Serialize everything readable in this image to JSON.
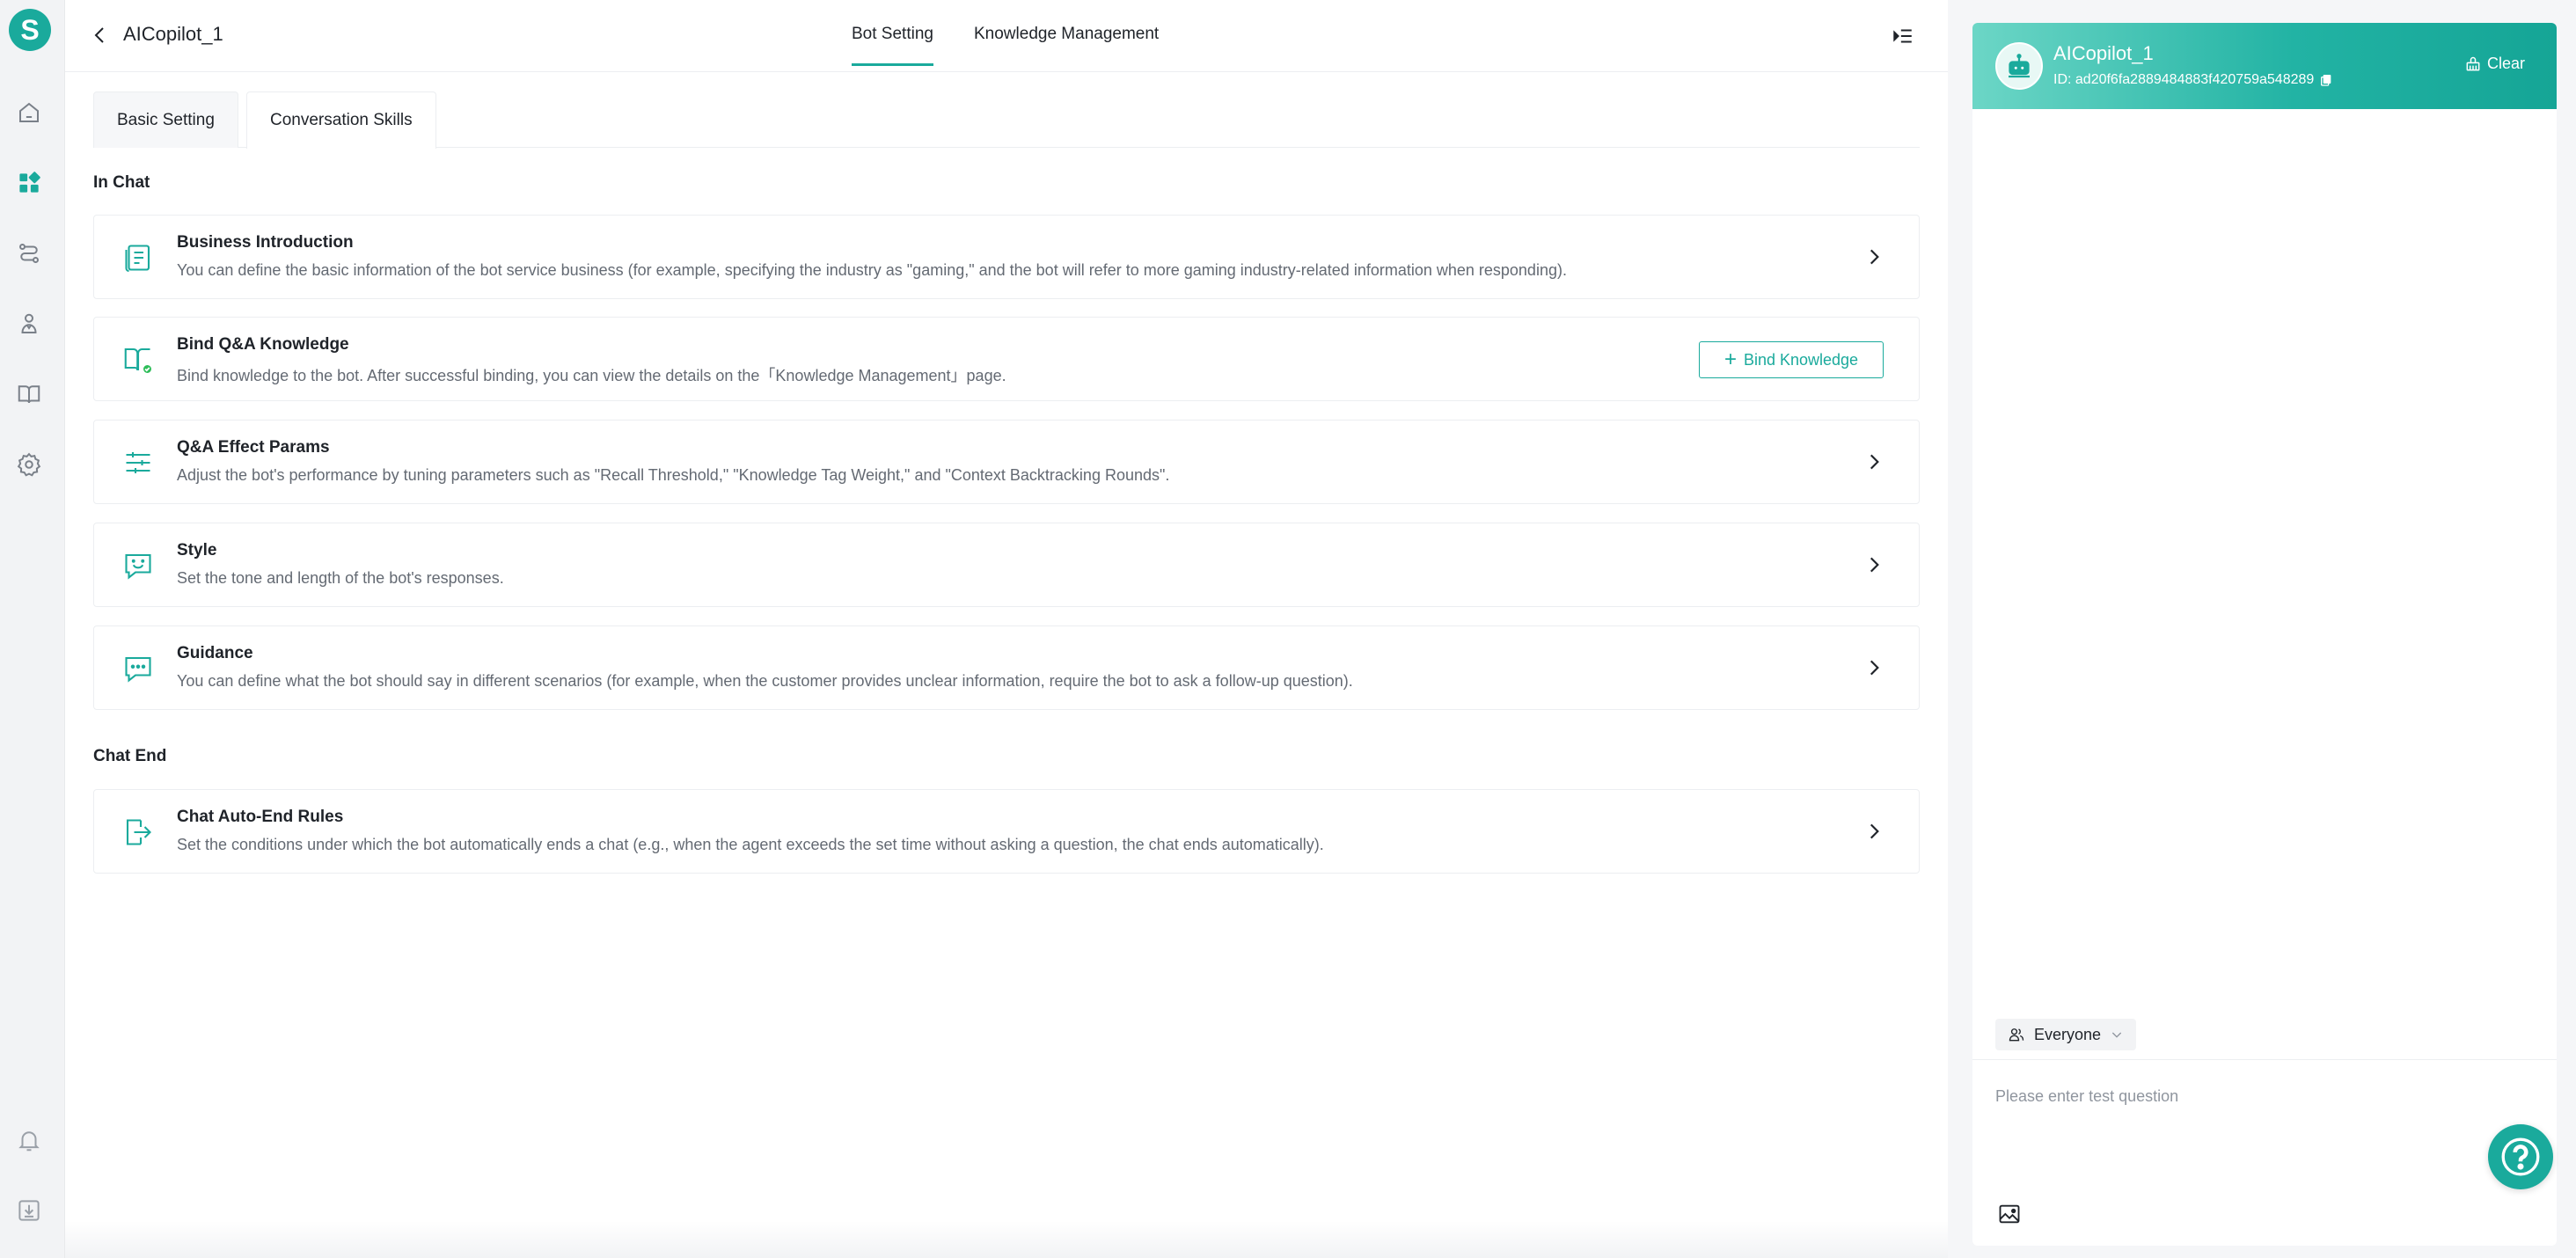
{
  "app": {
    "logo_letter": "S",
    "accent_color": "#1aaa9c"
  },
  "rail": {
    "items": [
      {
        "icon": "home-icon"
      },
      {
        "icon": "apps-icon",
        "active": true
      },
      {
        "icon": "route-icon"
      },
      {
        "icon": "people-icon"
      },
      {
        "icon": "book-icon"
      },
      {
        "icon": "gear-icon"
      }
    ],
    "bottom": [
      {
        "icon": "bell-icon"
      },
      {
        "icon": "download-icon"
      }
    ]
  },
  "header": {
    "bot_name": "AICopilot_1",
    "tabs": [
      {
        "label": "Bot Setting",
        "active": true
      },
      {
        "label": "Knowledge Management",
        "active": false
      }
    ]
  },
  "subtabs": [
    {
      "label": "Basic Setting",
      "active": false
    },
    {
      "label": "Conversation Skills",
      "active": true
    }
  ],
  "sections": {
    "in_chat": {
      "title": "In Chat",
      "cards": [
        {
          "icon": "document-icon",
          "title": "Business Introduction",
          "desc": "You can define the basic information of the bot service business (for example, specifying the industry as \"gaming,\" and the bot will refer to more gaming industry-related information when responding)."
        },
        {
          "icon": "book-check-icon",
          "title": "Bind Q&A Knowledge",
          "desc": "Bind knowledge to the bot. After successful binding, you can view the details on the「Knowledge Management」page.",
          "button": "Bind Knowledge"
        },
        {
          "icon": "sliders-icon",
          "title": "Q&A Effect Params",
          "desc": "Adjust the bot's performance by tuning parameters such as \"Recall Threshold,\" \"Knowledge Tag Weight,\" and \"Context Backtracking Rounds\"."
        },
        {
          "icon": "smile-chat-icon",
          "title": "Style",
          "desc": "Set the tone and length of the bot's responses."
        },
        {
          "icon": "chat-dots-icon",
          "title": "Guidance",
          "desc": "You can define what the bot should say in different scenarios (for example, when the customer provides unclear information, require the bot to ask a follow-up question)."
        }
      ]
    },
    "chat_end": {
      "title": "Chat End",
      "cards": [
        {
          "icon": "exit-icon",
          "title": "Chat Auto-End Rules",
          "desc": "Set the conditions under which the bot automatically ends a chat (e.g., when the agent exceeds the set time without asking a question, the chat ends automatically)."
        }
      ]
    }
  },
  "chat_panel": {
    "bot_name": "AICopilot_1",
    "bot_id": "ID: ad20f6fa2889484883f420759a548289",
    "clear_label": "Clear",
    "audience": "Everyone",
    "input_placeholder": "Please enter test question"
  }
}
